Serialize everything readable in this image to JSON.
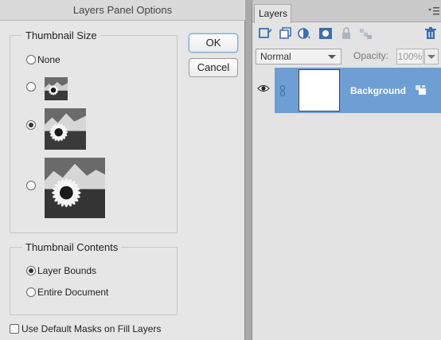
{
  "dialog": {
    "title": "Layers Panel Options",
    "thumbnail_size": {
      "legend": "Thumbnail Size",
      "options": [
        {
          "label": "None",
          "checked": false
        },
        {
          "label": "",
          "checked": false,
          "size": "small"
        },
        {
          "label": "",
          "checked": true,
          "size": "medium"
        },
        {
          "label": "",
          "checked": false,
          "size": "large"
        }
      ]
    },
    "thumbnail_contents": {
      "legend": "Thumbnail Contents",
      "options": [
        {
          "label": "Layer Bounds",
          "checked": true
        },
        {
          "label": "Entire Document",
          "checked": false
        }
      ]
    },
    "use_default_masks": {
      "label": "Use Default Masks on Fill Layers",
      "checked": false
    },
    "buttons": {
      "ok": "OK",
      "cancel": "Cancel"
    }
  },
  "layers_panel": {
    "tab_label": "Layers",
    "blend_mode": "Normal",
    "opacity_label": "Opacity:",
    "opacity_value": "100%",
    "toolbar_icons": [
      "new-layer-icon",
      "new-group-icon",
      "adjustment-layer-icon",
      "add-mask-icon",
      "lock-all-icon",
      "lock-transparency-icon",
      "delete-layer-icon"
    ],
    "layers": [
      {
        "name": "Background",
        "visible": true,
        "selected": true
      }
    ]
  },
  "colors": {
    "dialog_bg": "#e6e6e6",
    "selection": "#6d9fd5",
    "panel_bg": "#e3e3e3"
  }
}
